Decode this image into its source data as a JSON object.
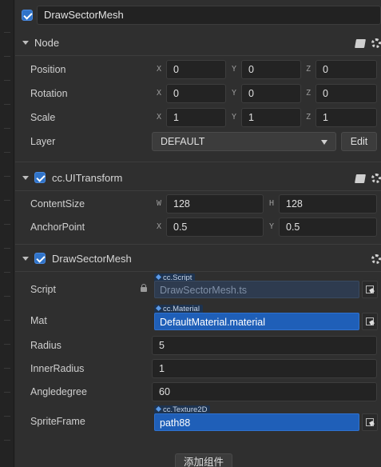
{
  "node_name": "DrawSectorMesh",
  "node_section": {
    "title": "Node",
    "position": {
      "label": "Position",
      "x_axis": "X",
      "y_axis": "Y",
      "z_axis": "Z",
      "x": "0",
      "y": "0",
      "z": "0"
    },
    "rotation": {
      "label": "Rotation",
      "x_axis": "X",
      "y_axis": "Y",
      "z_axis": "Z",
      "x": "0",
      "y": "0",
      "z": "0"
    },
    "scale": {
      "label": "Scale",
      "x_axis": "X",
      "y_axis": "Y",
      "z_axis": "Z",
      "x": "1",
      "y": "1",
      "z": "1"
    },
    "layer": {
      "label": "Layer",
      "value": "DEFAULT",
      "edit_label": "Edit"
    }
  },
  "uitransform_section": {
    "title": "cc.UITransform",
    "content_size": {
      "label": "ContentSize",
      "w_axis": "W",
      "h_axis": "H",
      "w": "128",
      "h": "128"
    },
    "anchor_point": {
      "label": "AnchorPoint",
      "x_axis": "X",
      "y_axis": "Y",
      "x": "0.5",
      "y": "0.5"
    }
  },
  "draw_sector_section": {
    "title": "DrawSectorMesh",
    "script": {
      "label": "Script",
      "type_tag": "cc.Script",
      "value": "DrawSectorMesh.ts"
    },
    "mat": {
      "label": "Mat",
      "type_tag": "cc.Material",
      "value": "DefaultMaterial.material"
    },
    "radius": {
      "label": "Radius",
      "value": "5"
    },
    "inner_radius": {
      "label": "InnerRadius",
      "value": "1"
    },
    "angle_degree": {
      "label": "Angledegree",
      "value": "60"
    },
    "sprite_frame": {
      "label": "SpriteFrame",
      "type_tag": "cc.Texture2D",
      "value": "path88"
    }
  },
  "add_component_label": "添加组件",
  "colors": {
    "accent": "#2f73c9",
    "asset_blue": "#1f5fb8",
    "panel": "#2f2f2f"
  }
}
